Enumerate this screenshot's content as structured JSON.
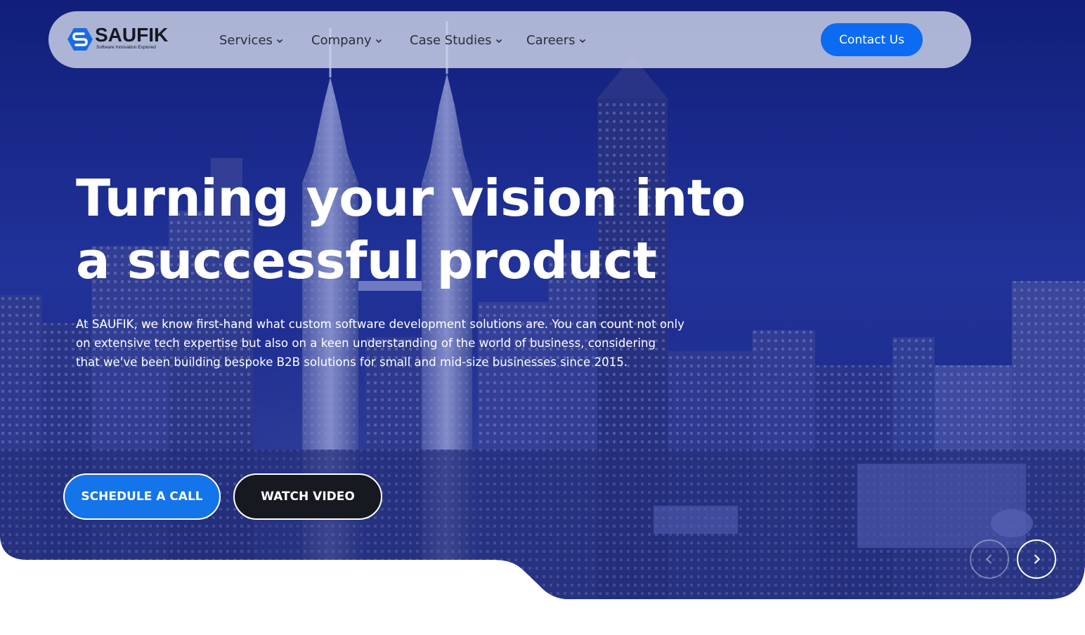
{
  "brand": {
    "name": "SAUFIK",
    "tagline": "Software Innovation Explored"
  },
  "nav": {
    "items": [
      {
        "label": "Services"
      },
      {
        "label": "Company"
      },
      {
        "label": "Case Studies"
      },
      {
        "label": "Careers"
      }
    ],
    "contact_label": "Contact Us"
  },
  "hero": {
    "headline_lines": [
      "Turning your vision into",
      "a successful product"
    ],
    "intro_lines": [
      "At SAUFIK, we know first-hand what custom software development solutions are. You can count not only",
      "on extensive tech expertise but also on a keen understanding of the world of business, considering",
      "that we've been building bespoke B2B solutions for small and mid-size businesses since 2015."
    ],
    "primary_cta": "SCHEDULE A CALL",
    "secondary_cta": "WATCH VIDEO"
  },
  "slider": {
    "prev_icon": "chevron-left-icon",
    "next_icon": "chevron-right-icon"
  },
  "colors": {
    "accent": "#0b6bf2",
    "hero_overlay": "#1c2a8c",
    "dark_button": "#16191f"
  }
}
